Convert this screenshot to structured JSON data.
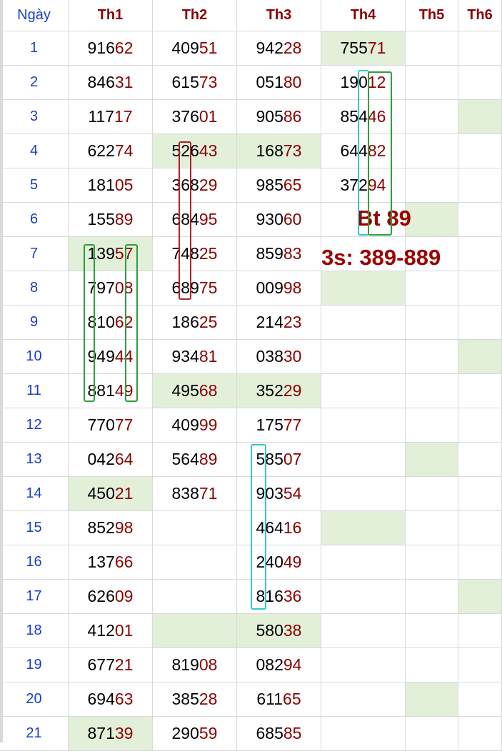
{
  "headers": [
    "Ngày",
    "Th1",
    "Th2",
    "Th3",
    "Th4",
    "Th5",
    "Th6"
  ],
  "rows": [
    {
      "day": "1",
      "vals": [
        "91662",
        "40951",
        "94228",
        "75571",
        "",
        ""
      ],
      "hl": [
        3
      ]
    },
    {
      "day": "2",
      "vals": [
        "84631",
        "61573",
        "05180",
        "19012",
        "",
        ""
      ],
      "hl": []
    },
    {
      "day": "3",
      "vals": [
        "11717",
        "37601",
        "90586",
        "85446",
        "",
        ""
      ],
      "hl": [
        5
      ]
    },
    {
      "day": "4",
      "vals": [
        "62274",
        "52643",
        "16873",
        "64482",
        "",
        ""
      ],
      "hl": [
        1,
        2
      ]
    },
    {
      "day": "5",
      "vals": [
        "18105",
        "36829",
        "98565",
        "37294",
        "",
        ""
      ],
      "hl": []
    },
    {
      "day": "6",
      "vals": [
        "15589",
        "68495",
        "93060",
        "",
        "",
        ""
      ],
      "hl": [
        4
      ]
    },
    {
      "day": "7",
      "vals": [
        "13957",
        "74825",
        "85983",
        "",
        "",
        ""
      ],
      "hl": [
        0
      ]
    },
    {
      "day": "8",
      "vals": [
        "79708",
        "68975",
        "00998",
        "",
        "",
        ""
      ],
      "hl": [
        3
      ]
    },
    {
      "day": "9",
      "vals": [
        "81062",
        "18625",
        "21423",
        "",
        "",
        ""
      ],
      "hl": []
    },
    {
      "day": "10",
      "vals": [
        "94944",
        "93481",
        "03830",
        "",
        "",
        ""
      ],
      "hl": [
        5
      ]
    },
    {
      "day": "11",
      "vals": [
        "88149",
        "49568",
        "35229",
        "",
        "",
        ""
      ],
      "hl": [
        1,
        2
      ]
    },
    {
      "day": "12",
      "vals": [
        "77077",
        "40999",
        "17577",
        "",
        "",
        ""
      ],
      "hl": []
    },
    {
      "day": "13",
      "vals": [
        "04264",
        "56489",
        "58507",
        "",
        "",
        ""
      ],
      "hl": [
        4
      ]
    },
    {
      "day": "14",
      "vals": [
        "45021",
        "83871",
        "90354",
        "",
        "",
        ""
      ],
      "hl": [
        0
      ]
    },
    {
      "day": "15",
      "vals": [
        "85298",
        "",
        "46416",
        "",
        "",
        ""
      ],
      "hl": [
        3
      ]
    },
    {
      "day": "16",
      "vals": [
        "13766",
        "",
        "24049",
        "",
        "",
        ""
      ],
      "hl": []
    },
    {
      "day": "17",
      "vals": [
        "62609",
        "",
        "81636",
        "",
        "",
        ""
      ],
      "hl": [
        5
      ]
    },
    {
      "day": "18",
      "vals": [
        "41201",
        "",
        "58038",
        "",
        "",
        ""
      ],
      "hl": [
        1,
        2
      ]
    },
    {
      "day": "19",
      "vals": [
        "67721",
        "81908",
        "08294",
        "",
        "",
        ""
      ],
      "hl": []
    },
    {
      "day": "20",
      "vals": [
        "69463",
        "38528",
        "61165",
        "",
        "",
        ""
      ],
      "hl": [
        4
      ]
    },
    {
      "day": "21",
      "vals": [
        "87139",
        "29059",
        "68585",
        "",
        "",
        ""
      ],
      "hl": [
        0
      ]
    }
  ],
  "annotations": {
    "bt": "Bt 89",
    "three_s": "3s: 389-889"
  },
  "colors": {
    "highlight": "#e2efd9",
    "header_red": "#8b0000",
    "day_blue": "#1a3dc8",
    "green_box": "#2e9e3e",
    "red_box": "#b0202a",
    "cyan_box": "#33c8c8"
  }
}
